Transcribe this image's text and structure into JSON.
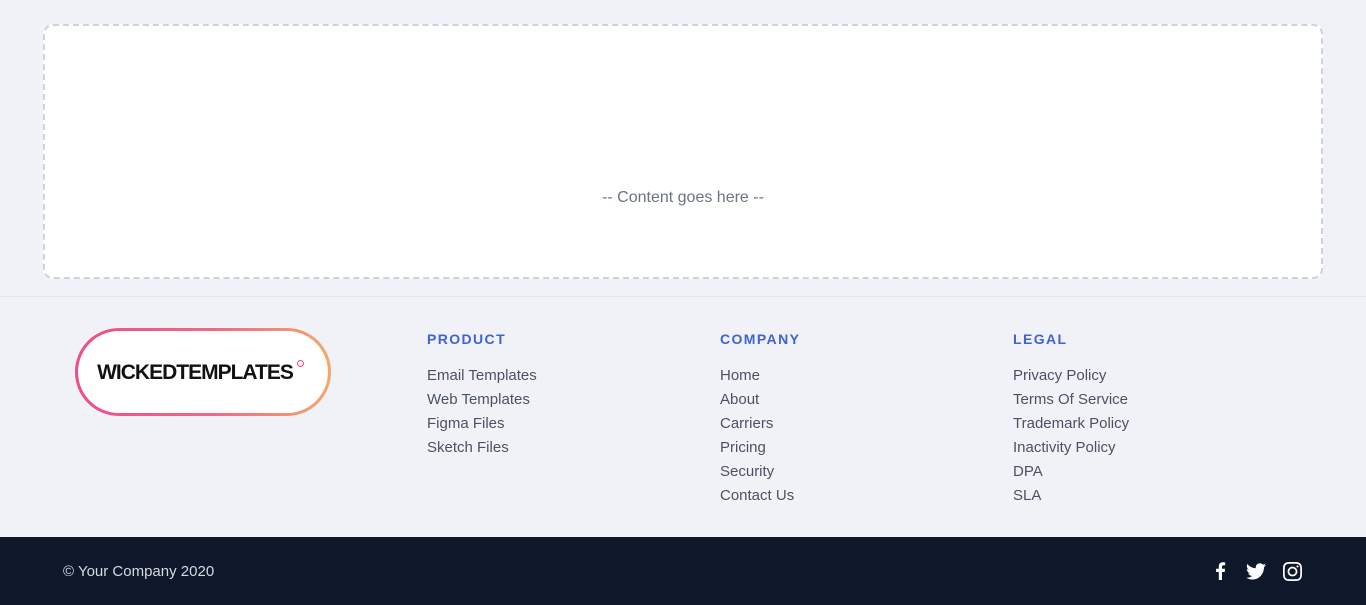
{
  "main": {
    "placeholder": "-- Content goes here --"
  },
  "footer": {
    "logo_text": "WICKEDTEMPLATES",
    "columns": [
      {
        "title": "PRODUCT",
        "links": [
          "Email Templates",
          "Web Templates",
          "Figma Files",
          "Sketch Files"
        ]
      },
      {
        "title": "COMPANY",
        "links": [
          "Home",
          "About",
          "Carriers",
          "Pricing",
          "Security",
          "Contact Us"
        ]
      },
      {
        "title": "LEGAL",
        "links": [
          "Privacy Policy",
          "Terms Of Service",
          "Trademark Policy",
          "Inactivity Policy",
          "DPA",
          "SLA"
        ]
      }
    ],
    "copyright": "© Your Company 2020",
    "socials": [
      "facebook-icon",
      "twitter-icon",
      "instagram-icon"
    ]
  },
  "colors": {
    "accent": "#4063d2",
    "bottom_bar": "#0f172a",
    "logo_gradient_start": "#ec4d8a",
    "logo_gradient_end": "#f2a86a"
  }
}
